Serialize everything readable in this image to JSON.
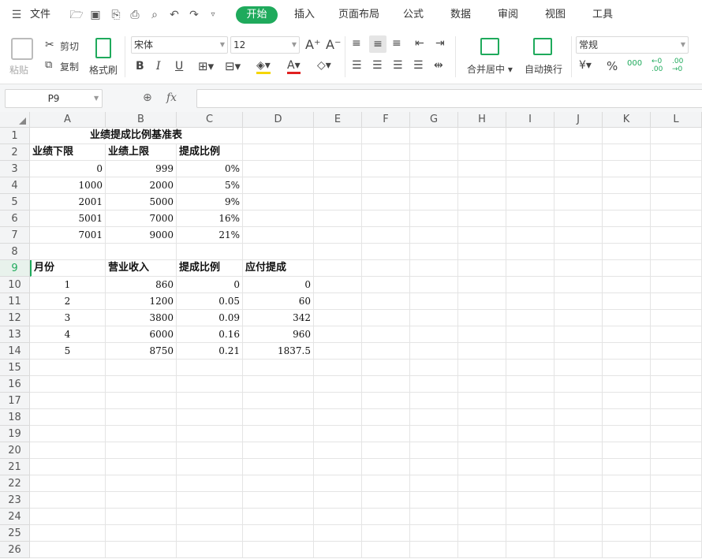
{
  "menubar": {
    "file_label": "文件",
    "tabs": [
      "开始",
      "插入",
      "页面布局",
      "公式",
      "数据",
      "审阅",
      "视图",
      "工具"
    ],
    "accent": "#1faa5c"
  },
  "ribbon": {
    "paste": "粘贴",
    "cut": "剪切",
    "copy": "复制",
    "format_painter": "格式刷",
    "font_name": "宋体",
    "font_size": "12",
    "merge_center": "合并居中",
    "wrap_text": "自动换行",
    "number_format": "常规"
  },
  "formula_bar": {
    "name_box": "P9",
    "fx": "fx",
    "value": ""
  },
  "columns": [
    "A",
    "B",
    "C",
    "D",
    "E",
    "F",
    "G",
    "H",
    "I",
    "J",
    "K",
    "L"
  ],
  "rows": [
    "1",
    "2",
    "3",
    "4",
    "5",
    "6",
    "7",
    "8",
    "9",
    "10",
    "11",
    "12",
    "13",
    "14",
    "15",
    "16",
    "17",
    "18",
    "19",
    "20",
    "21",
    "22",
    "23",
    "24",
    "25",
    "26"
  ],
  "sheet": {
    "title": "业绩提成比例基准表",
    "table1_headers": [
      "业绩下限",
      "业绩上限",
      "提成比例"
    ],
    "table1_rows": [
      [
        "0",
        "999",
        "0%"
      ],
      [
        "1000",
        "2000",
        "5%"
      ],
      [
        "2001",
        "5000",
        "9%"
      ],
      [
        "5001",
        "7000",
        "16%"
      ],
      [
        "7001",
        "9000",
        "21%"
      ]
    ],
    "table2_headers": [
      "月份",
      "营业收入",
      "提成比例",
      "应付提成"
    ],
    "table2_rows": [
      [
        "1",
        "860",
        "0",
        "0"
      ],
      [
        "2",
        "1200",
        "0.05",
        "60"
      ],
      [
        "3",
        "3800",
        "0.09",
        "342"
      ],
      [
        "4",
        "6000",
        "0.16",
        "960"
      ],
      [
        "5",
        "8750",
        "0.21",
        "1837.5"
      ]
    ]
  }
}
